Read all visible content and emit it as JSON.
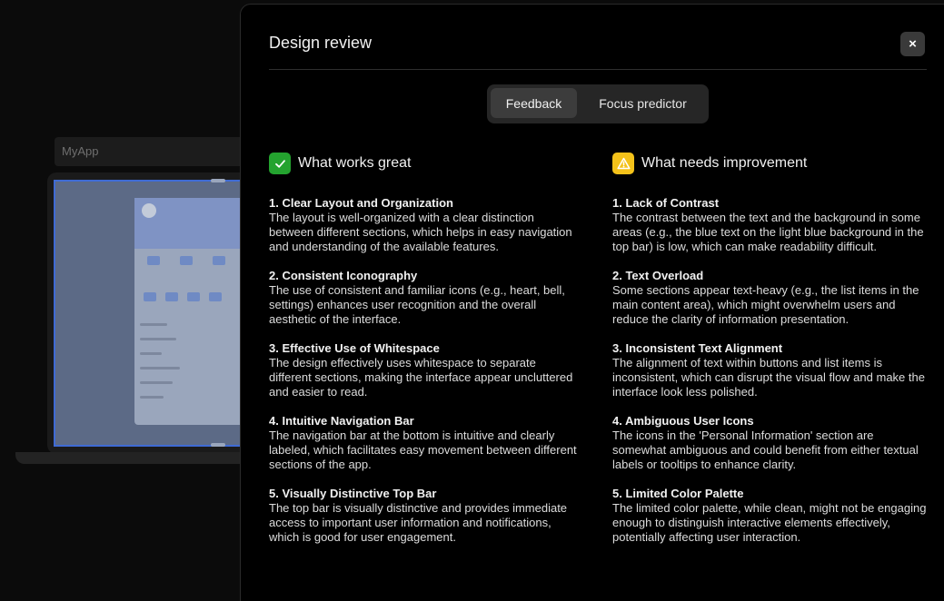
{
  "background": {
    "app_name": "MyApp"
  },
  "panel": {
    "title": "Design review",
    "close_label": "×",
    "tabs": [
      {
        "label": "Feedback",
        "active": true
      },
      {
        "label": "Focus predictor",
        "active": false
      }
    ]
  },
  "works": {
    "title": "What works great",
    "icon": "check-icon",
    "color": "#24a32f",
    "items": [
      {
        "title": "1. Clear Layout and Organization",
        "desc": "The layout is well-organized with a clear distinction between different sections, which helps in easy navigation and understanding of the available features."
      },
      {
        "title": "2. Consistent Iconography",
        "desc": "The use of consistent and familiar icons (e.g., heart, bell, settings) enhances user recognition and the overall aesthetic of the interface."
      },
      {
        "title": "3. Effective Use of Whitespace",
        "desc": "The design effectively uses whitespace to separate different sections, making the interface appear uncluttered and easier to read."
      },
      {
        "title": "4. Intuitive Navigation Bar",
        "desc": "The navigation bar at the bottom is intuitive and clearly labeled, which facilitates easy movement between different sections of the app."
      },
      {
        "title": "5. Visually Distinctive Top Bar",
        "desc": "The top bar is visually distinctive and provides immediate access to important user information and notifications, which is good for user engagement."
      }
    ]
  },
  "improve": {
    "title": "What needs improvement",
    "icon": "warning-icon",
    "color": "#f4c21a",
    "items": [
      {
        "title": "1. Lack of Contrast",
        "desc": "The contrast between the text and the background in some areas (e.g., the blue text on the light blue background in the top bar) is low, which can make readability difficult."
      },
      {
        "title": "2. Text Overload",
        "desc": "Some sections appear text-heavy (e.g., the list items in the main content area), which might overwhelm users and reduce the clarity of information presentation."
      },
      {
        "title": "3. Inconsistent Text Alignment",
        "desc": "The alignment of text within buttons and list items is inconsistent, which can disrupt the visual flow and make the interface look less polished."
      },
      {
        "title": "4. Ambiguous User Icons",
        "desc": "The icons in the 'Personal Information' section are somewhat ambiguous and could benefit from either textual labels or tooltips to enhance clarity."
      },
      {
        "title": "5. Limited Color Palette",
        "desc": "The limited color palette, while clean, might not be engaging enough to distinguish interactive elements effectively, potentially affecting user interaction."
      }
    ]
  }
}
